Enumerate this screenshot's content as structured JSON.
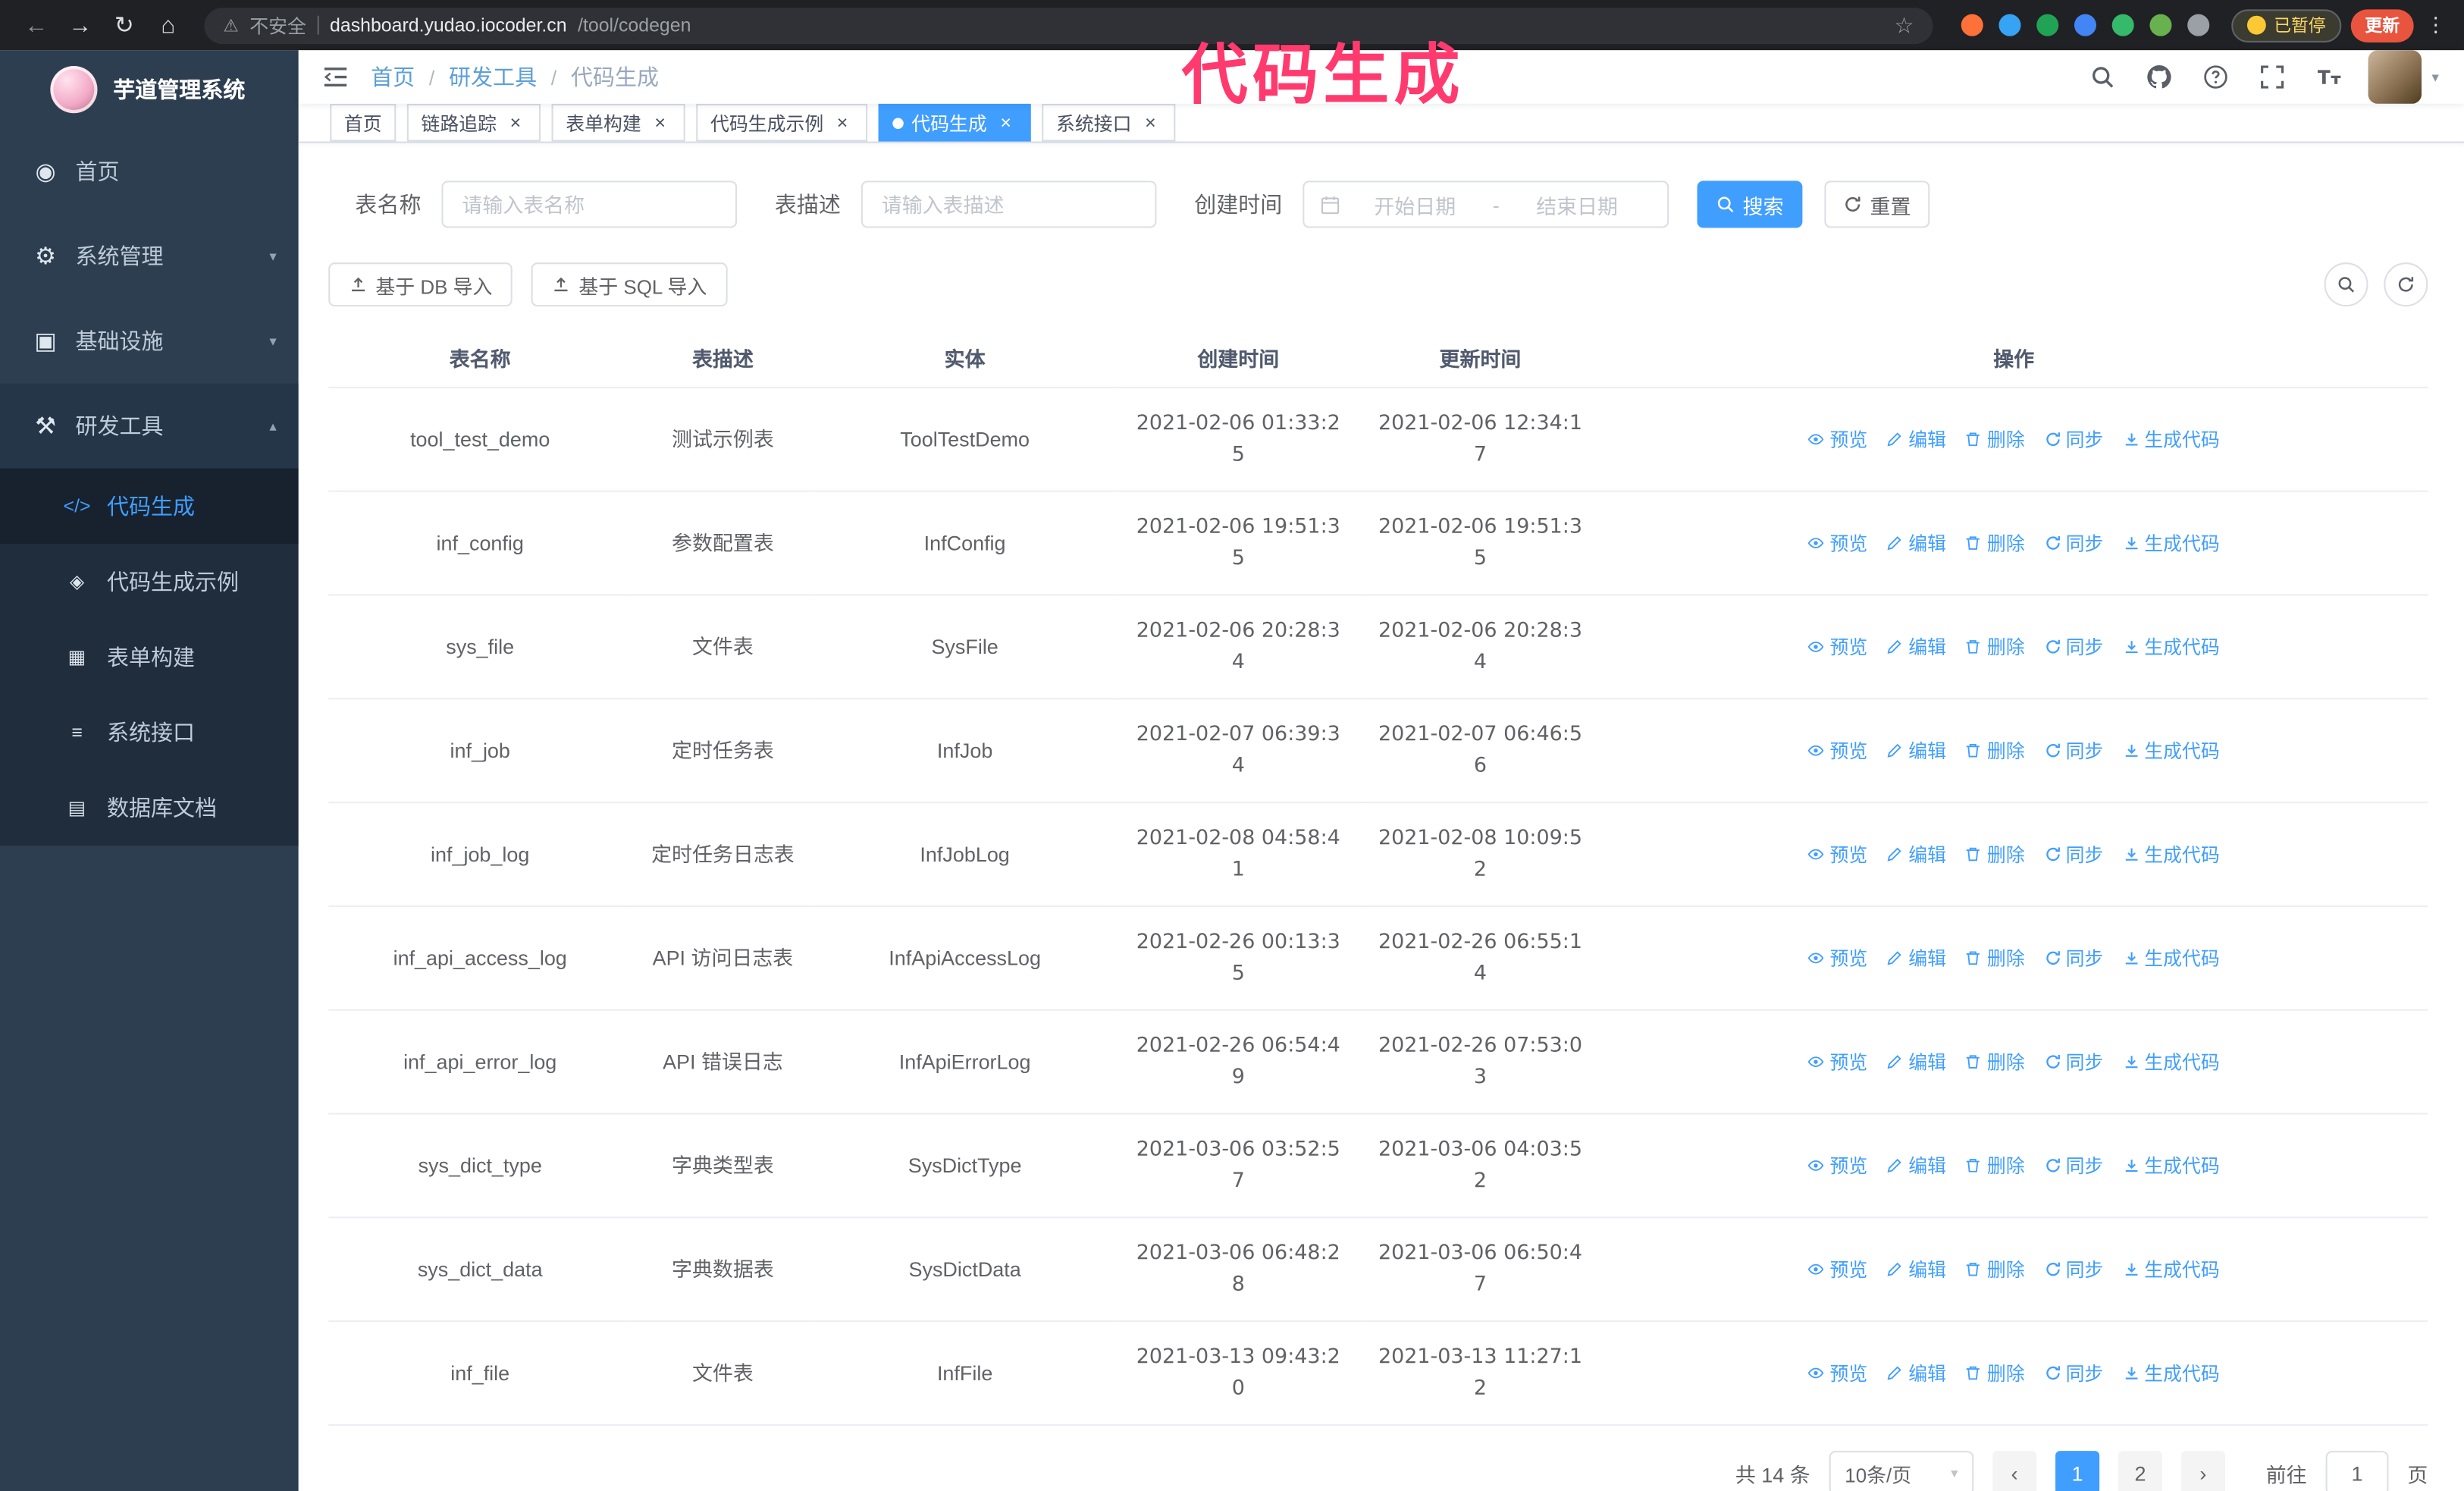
{
  "ui": {
    "back_glyph": "←",
    "forward_glyph": "→",
    "reload_glyph": "↻",
    "home_glyph": "⌂",
    "warning_glyph": "⚠",
    "star_glyph": "☆",
    "kebab_glyph": "⋮",
    "caret_down": "▾",
    "chevron_up": "▴",
    "chevron_down": "▾",
    "close_glyph": "×",
    "breadcrumb_sep": "/"
  },
  "annotation": {
    "text": "代码生成",
    "color": "#ff3a6e"
  },
  "browser": {
    "insecure_label": "不安全",
    "url_host": "dashboard.yudao.iocoder.cn",
    "url_path": "/tool/codegen",
    "paused_badge": "已暂停",
    "update_label": "更新",
    "extensions": [
      {
        "name": "fox-extension-icon",
        "color": "#ff7139"
      },
      {
        "name": "drop-extension-icon",
        "color": "#37a3f4"
      },
      {
        "name": "check-extension-icon",
        "color": "#21a356"
      },
      {
        "name": "people-extension-icon",
        "color": "#4285f4"
      },
      {
        "name": "card-extension-icon",
        "color": "#35b96b"
      },
      {
        "name": "leaf-extension-icon",
        "color": "#67b14e"
      },
      {
        "name": "puzzle-icon",
        "color": "#9aa0a6"
      }
    ]
  },
  "sidebar": {
    "app_title": "芋道管理系统",
    "menu": [
      {
        "id": "home",
        "label": "首页",
        "icon": "home-icon",
        "glyph": "◉"
      },
      {
        "id": "system-management",
        "label": "系统管理",
        "icon": "gear-icon",
        "glyph": "⚙",
        "chevron": "down"
      },
      {
        "id": "infrastructure",
        "label": "基础设施",
        "icon": "infrastructure-icon",
        "glyph": "▣",
        "chevron": "down"
      },
      {
        "id": "dev-tools",
        "label": "研发工具",
        "icon": "dev-tools-icon",
        "glyph": "⚒",
        "chevron": "up",
        "open": true
      }
    ],
    "submenu": [
      {
        "id": "codegen",
        "label": "代码生成",
        "icon": "code-icon",
        "glyph": "</>",
        "active": true
      },
      {
        "id": "codegen-example",
        "label": "代码生成示例",
        "icon": "example-icon",
        "glyph": "◈"
      },
      {
        "id": "form-builder",
        "label": "表单构建",
        "icon": "form-builder-icon",
        "glyph": "▦"
      },
      {
        "id": "system-api",
        "label": "系统接口",
        "icon": "api-icon",
        "glyph": "≡"
      },
      {
        "id": "db-doc",
        "label": "数据库文档",
        "icon": "database-doc-icon",
        "glyph": "▤"
      }
    ]
  },
  "navbar": {
    "breadcrumb": [
      "首页",
      "研发工具",
      "代码生成"
    ],
    "icons": [
      {
        "name": "search-icon"
      },
      {
        "name": "github-icon"
      },
      {
        "name": "help-icon"
      },
      {
        "name": "fullscreen-icon"
      },
      {
        "name": "font-size-icon"
      }
    ]
  },
  "tabs": [
    {
      "id": "home",
      "label": "首页",
      "closable": false
    },
    {
      "id": "tracer",
      "label": "链路追踪",
      "closable": true
    },
    {
      "id": "form-builder",
      "label": "表单构建",
      "closable": true
    },
    {
      "id": "codegen-example",
      "label": "代码生成示例",
      "closable": true
    },
    {
      "id": "codegen",
      "label": "代码生成",
      "closable": true,
      "active": true
    },
    {
      "id": "system-api",
      "label": "系统接口",
      "closable": true
    }
  ],
  "filters": {
    "table_name_label": "表名称",
    "table_name_placeholder": "请输入表名称",
    "table_desc_label": "表描述",
    "table_desc_placeholder": "请输入表描述",
    "create_time_label": "创建时间",
    "date_start_placeholder": "开始日期",
    "date_separator": "-",
    "date_end_placeholder": "结束日期",
    "search_label": "搜索",
    "reset_label": "重置"
  },
  "toolbar": {
    "import_db_label": "基于 DB 导入",
    "import_sql_label": "基于 SQL 导入"
  },
  "table": {
    "columns": [
      "表名称",
      "表描述",
      "实体",
      "创建时间",
      "更新时间",
      "操作"
    ],
    "row_actions": [
      {
        "id": "preview",
        "label": "预览",
        "icon": "eye-icon"
      },
      {
        "id": "edit",
        "label": "编辑",
        "icon": "edit-icon"
      },
      {
        "id": "delete",
        "label": "删除",
        "icon": "delete-icon"
      },
      {
        "id": "sync",
        "label": "同步",
        "icon": "sync-icon"
      },
      {
        "id": "generate",
        "label": "生成代码",
        "icon": "download-icon"
      }
    ],
    "rows": [
      {
        "name": "tool_test_demo",
        "desc": "测试示例表",
        "entity": "ToolTestDemo",
        "created": "2021-02-06 01:33:25",
        "updated": "2021-02-06 12:34:17"
      },
      {
        "name": "inf_config",
        "desc": "参数配置表",
        "entity": "InfConfig",
        "created": "2021-02-06 19:51:35",
        "updated": "2021-02-06 19:51:35"
      },
      {
        "name": "sys_file",
        "desc": "文件表",
        "entity": "SysFile",
        "created": "2021-02-06 20:28:34",
        "updated": "2021-02-06 20:28:34"
      },
      {
        "name": "inf_job",
        "desc": "定时任务表",
        "entity": "InfJob",
        "created": "2021-02-07 06:39:34",
        "updated": "2021-02-07 06:46:56"
      },
      {
        "name": "inf_job_log",
        "desc": "定时任务日志表",
        "entity": "InfJobLog",
        "created": "2021-02-08 04:58:41",
        "updated": "2021-02-08 10:09:52"
      },
      {
        "name": "inf_api_access_log",
        "desc": "API 访问日志表",
        "entity": "InfApiAccessLog",
        "created": "2021-02-26 00:13:35",
        "updated": "2021-02-26 06:55:14"
      },
      {
        "name": "inf_api_error_log",
        "desc": "API 错误日志",
        "entity": "InfApiErrorLog",
        "created": "2021-02-26 06:54:49",
        "updated": "2021-02-26 07:53:03"
      },
      {
        "name": "sys_dict_type",
        "desc": "字典类型表",
        "entity": "SysDictType",
        "created": "2021-03-06 03:52:57",
        "updated": "2021-03-06 04:03:52"
      },
      {
        "name": "sys_dict_data",
        "desc": "字典数据表",
        "entity": "SysDictData",
        "created": "2021-03-06 06:48:28",
        "updated": "2021-03-06 06:50:47"
      },
      {
        "name": "inf_file",
        "desc": "文件表",
        "entity": "InfFile",
        "created": "2021-03-13 09:43:20",
        "updated": "2021-03-13 11:27:12"
      }
    ]
  },
  "pagination": {
    "total_label": "共 14 条",
    "page_size_label": "10条/页",
    "prev_glyph": "‹",
    "next_glyph": "›",
    "pages": [
      "1",
      "2"
    ],
    "active_page": "1",
    "goto_label": "前往",
    "goto_value": "1",
    "page_unit_label": "页"
  },
  "colors": {
    "primary": "#409eff",
    "sidebar_bg": "#2d3e50",
    "submenu_bg": "#1f2d3d",
    "chrome_bg": "#202124",
    "annotation_pink": "#ff3a6e",
    "update_button_bg": "#e8543e",
    "paused_badge_text": "#fdd663"
  }
}
